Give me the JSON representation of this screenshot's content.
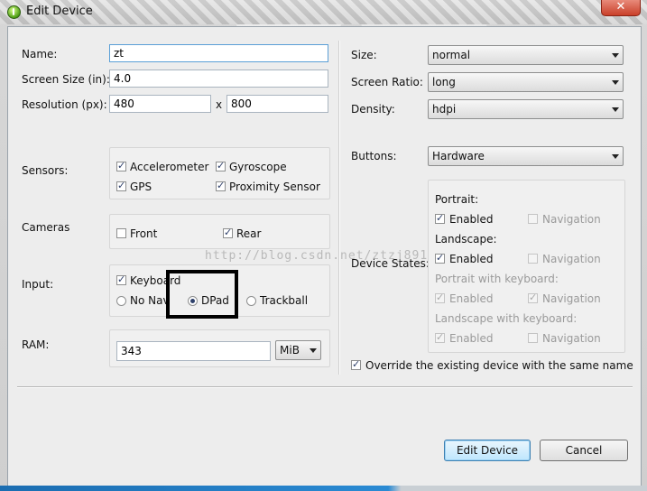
{
  "window": {
    "title": "Edit Device",
    "close_glyph": "✕"
  },
  "left": {
    "name": {
      "label": "Name:",
      "value": "zt"
    },
    "screen_size": {
      "label": "Screen Size (in):",
      "value": "4.0"
    },
    "resolution": {
      "label": "Resolution (px):",
      "width": "480",
      "separator": "x",
      "height": "800"
    },
    "sensors": {
      "label": "Sensors:",
      "accelerometer": {
        "label": "Accelerometer",
        "checked": true
      },
      "gyroscope": {
        "label": "Gyroscope",
        "checked": true
      },
      "gps": {
        "label": "GPS",
        "checked": true
      },
      "proximity": {
        "label": "Proximity Sensor",
        "checked": true
      }
    },
    "cameras": {
      "label": "Cameras",
      "front": {
        "label": "Front",
        "checked": false
      },
      "rear": {
        "label": "Rear",
        "checked": true
      }
    },
    "input": {
      "label": "Input:",
      "keyboard": {
        "label": "Keyboard",
        "checked": true
      },
      "no_nav": {
        "label": "No Nav",
        "selected": false
      },
      "dpad": {
        "label": "DPad",
        "selected": true
      },
      "trackball": {
        "label": "Trackball",
        "selected": false
      }
    },
    "ram": {
      "label": "RAM:",
      "value": "343",
      "unit": "MiB"
    }
  },
  "right": {
    "size": {
      "label": "Size:",
      "value": "normal"
    },
    "screen_ratio": {
      "label": "Screen Ratio:",
      "value": "long"
    },
    "density": {
      "label": "Density:",
      "value": "hdpi"
    },
    "buttons": {
      "label": "Buttons:",
      "value": "Hardware"
    },
    "device_states": {
      "label": "Device States:",
      "portrait": {
        "label": "Portrait:",
        "enabled": "Enabled",
        "navigation": "Navigation"
      },
      "landscape": {
        "label": "Landscape:",
        "enabled": "Enabled",
        "navigation": "Navigation"
      },
      "portrait_kb": {
        "label": "Portrait with keyboard:",
        "enabled": "Enabled",
        "navigation": "Navigation"
      },
      "landscape_kb": {
        "label": "Landscape with keyboard:",
        "enabled": "Enabled",
        "navigation": "Navigation"
      }
    },
    "override": {
      "label": "Override the existing device with the same name",
      "checked": true
    }
  },
  "footer": {
    "edit_label": "Edit Device",
    "cancel_label": "Cancel"
  },
  "watermark": "http://blog.csdn.net/ztzj891"
}
